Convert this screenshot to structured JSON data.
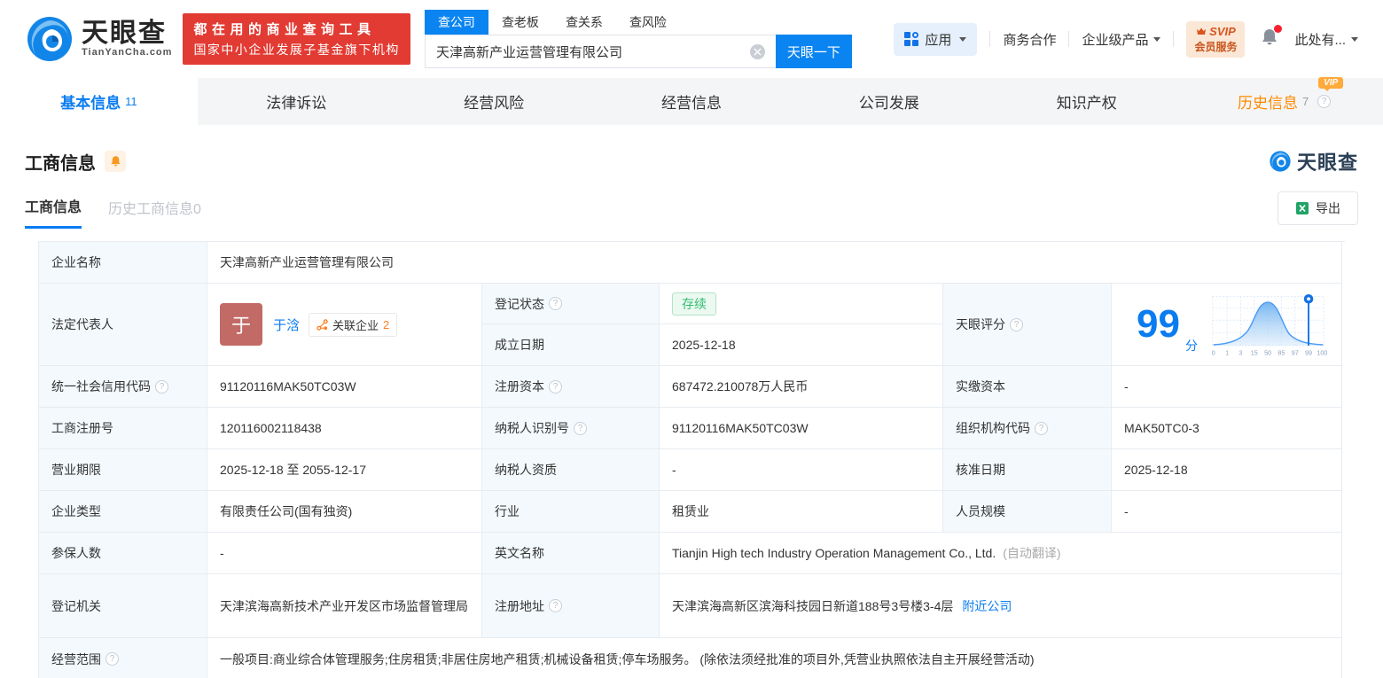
{
  "brand": {
    "logo_cn": "天眼查",
    "logo_en": "TianYanCha.com",
    "slogan_line1": "都在用的商业查询工具",
    "slogan_line2": "国家中小企业发展子基金旗下机构"
  },
  "search": {
    "tabs": [
      "查公司",
      "查老板",
      "查关系",
      "查风险"
    ],
    "value": "天津高新产业运营管理有限公司",
    "button": "天眼一下"
  },
  "topnav": {
    "apps": "应用",
    "biz_coop": "商务合作",
    "enterprise": "企业级产品",
    "svip_line1": "SVIP",
    "svip_line2": "会员服务",
    "user": "此处有..."
  },
  "icons": {
    "help": "?"
  },
  "tabs": {
    "items": [
      {
        "label": "基本信息",
        "count": "11"
      },
      {
        "label": "法律诉讼"
      },
      {
        "label": "经营风险"
      },
      {
        "label": "经营信息"
      },
      {
        "label": "公司发展"
      },
      {
        "label": "知识产权"
      },
      {
        "label": "历史信息",
        "count": "7",
        "vip": "VIP"
      }
    ]
  },
  "section": {
    "title": "工商信息",
    "subtab_active": "工商信息",
    "subtab_history": "历史工商信息",
    "subtab_history_count": "0",
    "watermark": "天眼查",
    "export": "导出"
  },
  "fields": {
    "name_label": "企业名称",
    "name": "天津高新产业运营管理有限公司",
    "legal_label": "法定代表人",
    "legal_avatar": "于",
    "legal_name": "于浛",
    "related_label": "关联企业",
    "related_count": "2",
    "status_label": "登记状态",
    "status": "存续",
    "estab_label": "成立日期",
    "estab": "2025-12-18",
    "score_label": "天眼评分",
    "score": "99",
    "score_unit": "分",
    "uscc_label": "统一社会信用代码",
    "uscc": "91120116MAK50TC03W",
    "regcap_label": "注册资本",
    "regcap": "687472.210078万人民币",
    "paidcap_label": "实缴资本",
    "paidcap": "-",
    "regno_label": "工商注册号",
    "regno": "120116002118438",
    "taxid_label": "纳税人识别号",
    "taxid": "91120116MAK50TC03W",
    "orgcode_label": "组织机构代码",
    "orgcode": "MAK50TC0-3",
    "term_label": "营业期限",
    "term": "2025-12-18 至 2055-12-17",
    "taxqual_label": "纳税人资质",
    "taxqual": "-",
    "approve_label": "核准日期",
    "approve": "2025-12-18",
    "type_label": "企业类型",
    "type": "有限责任公司(国有独资)",
    "industry_label": "行业",
    "industry": "租赁业",
    "staff_label": "人员规模",
    "staff": "-",
    "insured_label": "参保人数",
    "insured": "-",
    "en_label": "英文名称",
    "en_name": "Tianjin High tech Industry Operation Management Co., Ltd.",
    "en_note": "(自动翻译)",
    "authority_label": "登记机关",
    "authority": "天津滨海高新技术产业开发区市场监督管理局",
    "address_label": "注册地址",
    "address": "天津滨海高新区滨海科技园日新道188号3号楼3-4层",
    "nearby": "附近公司",
    "scope_label": "经营范围",
    "scope": "一般项目:商业综合体管理服务;住房租赁;非居住房地产租赁;机械设备租赁;停车场服务。 (除依法须经批准的项目外,凭营业执照依法自主开展经营活动)"
  },
  "chart_data": {
    "type": "area",
    "title": "天眼评分分布曲线",
    "score": 99,
    "ticks": [
      "0",
      "1",
      "3",
      "15",
      "50",
      "85",
      "97",
      "99",
      "100"
    ],
    "marker_at": "99",
    "accent_color": "#0a7cf0",
    "fill_color": "#7db9f2"
  }
}
